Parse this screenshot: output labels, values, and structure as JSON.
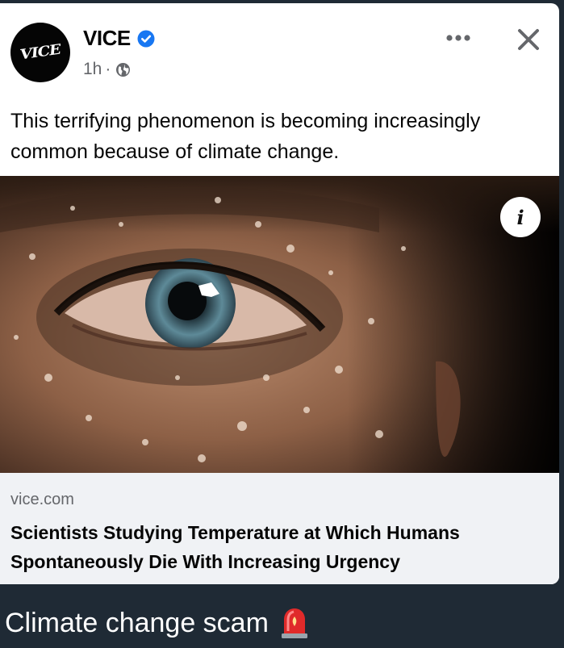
{
  "post": {
    "page_name": "VICE",
    "avatar_logo": "VICE",
    "time": "1h",
    "separator": "·",
    "audience_icon": "globe-icon",
    "verified_icon": "verified-badge-icon",
    "more_icon": "more-options-icon",
    "close_icon": "close-icon",
    "text": "This terrifying phenomenon is becoming increasingly common because of climate change."
  },
  "link_preview": {
    "info_icon": "info-icon",
    "info_glyph": "i",
    "domain": "vice.com",
    "headline": "Scientists Studying Temperature at Which Humans Spontaneously Die With Increasing Urgency"
  },
  "caption": {
    "text": "Climate change scam",
    "emoji_icon": "siren-emoji-icon"
  },
  "colors": {
    "background": "#1f2a35",
    "card": "#ffffff",
    "link_footer": "#f0f2f5",
    "verified_blue": "#1877f2",
    "secondary_text": "#65676b",
    "primary_text": "#050505"
  }
}
